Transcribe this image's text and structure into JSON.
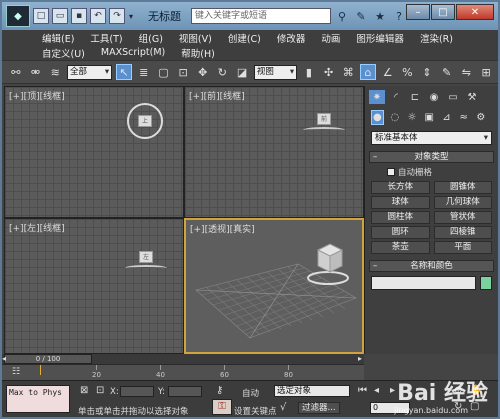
{
  "window": {
    "title": "无标题",
    "search_placeholder": "键入关键字或短语"
  },
  "menu": {
    "row1": [
      "编辑(E)",
      "工具(T)",
      "组(G)",
      "视图(V)",
      "创建(C)",
      "修改器",
      "动画",
      "图形编辑器",
      "渲染(R)"
    ],
    "row2": [
      "自定义(U)",
      "MAXScript(M)",
      "帮助(H)"
    ]
  },
  "toolbar": {
    "filter_select": "全部",
    "ref_coord_select": "视图"
  },
  "viewports": {
    "top": "[+][顶][线框]",
    "front": "[+][前][线框]",
    "left": "[+][左][线框]",
    "persp": "[+][透视][真实]"
  },
  "command_panel": {
    "category_select": "标准基本体",
    "object_type_title": "对象类型",
    "autogrid_label": "自动栅格",
    "objects": [
      "长方体",
      "圆锥体",
      "球体",
      "几何球体",
      "圆柱体",
      "管状体",
      "圆环",
      "四棱锥",
      "茶壶",
      "平面"
    ],
    "name_color_title": "名称和颜色",
    "accent_color": "#7ad39e"
  },
  "timeline": {
    "slider_text": "0 / 100",
    "ticks": [
      "20",
      "40",
      "60",
      "80"
    ]
  },
  "status": {
    "maxscript_text": "Max to Phys",
    "x_label": "X:",
    "y_label": "Y:",
    "prompt_text": "单击或单击并拖动以选择对象",
    "auto_label": "自动",
    "set_key_label": "设置关键点",
    "selected_select": "选定对象",
    "filter_label": "过滤器...",
    "frame_value": "0"
  },
  "watermark": {
    "text": "Bai 经验",
    "sub": "jingyan.baidu.com"
  }
}
